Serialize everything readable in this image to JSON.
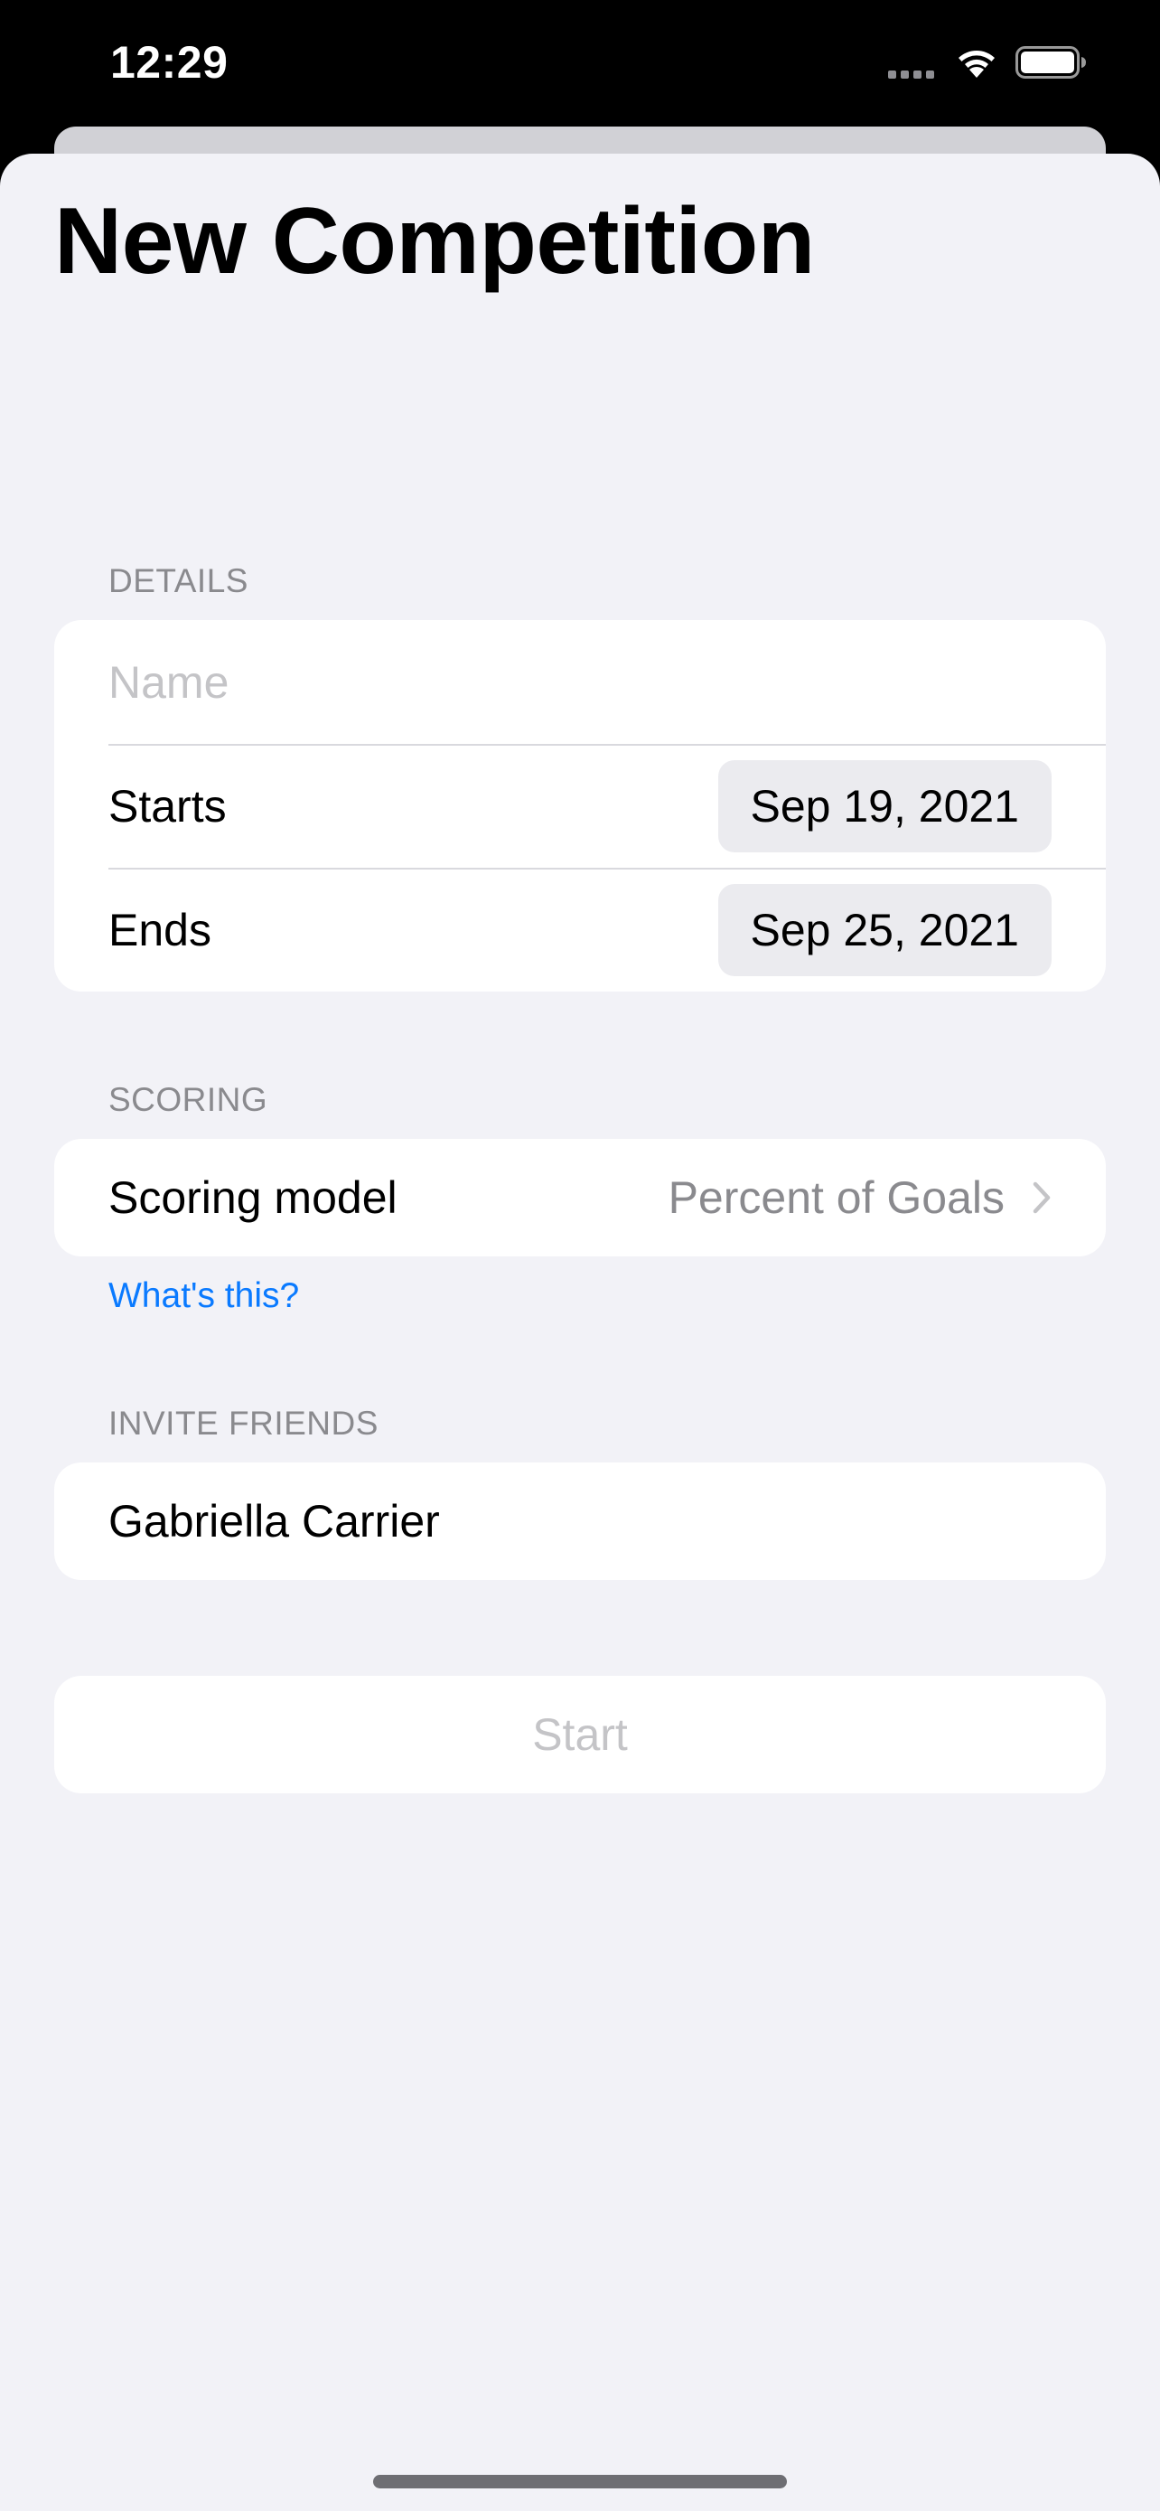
{
  "status_bar": {
    "time": "12:29",
    "signal_icon": "signal-dots-icon",
    "wifi_icon": "wifi-icon",
    "battery_icon": "battery-full-icon"
  },
  "page": {
    "title": "New Competition"
  },
  "details": {
    "header": "DETAILS",
    "name_placeholder": "Name",
    "name_value": "",
    "starts_label": "Starts",
    "starts_value": "Sep 19, 2021",
    "ends_label": "Ends",
    "ends_value": "Sep 25, 2021"
  },
  "scoring": {
    "header": "SCORING",
    "model_label": "Scoring model",
    "model_value": "Percent of Goals",
    "chevron_icon": "chevron-right-icon",
    "help_link": "What's this?"
  },
  "invite": {
    "header": "INVITE FRIENDS",
    "friends": [
      "Gabriella Carrier"
    ]
  },
  "actions": {
    "start_label": "Start"
  },
  "colors": {
    "background": "#f2f2f7",
    "card": "#ffffff",
    "link": "#0a7aff",
    "secondary_text": "#8a8a8e",
    "disabled_text": "#c4c4c7"
  }
}
